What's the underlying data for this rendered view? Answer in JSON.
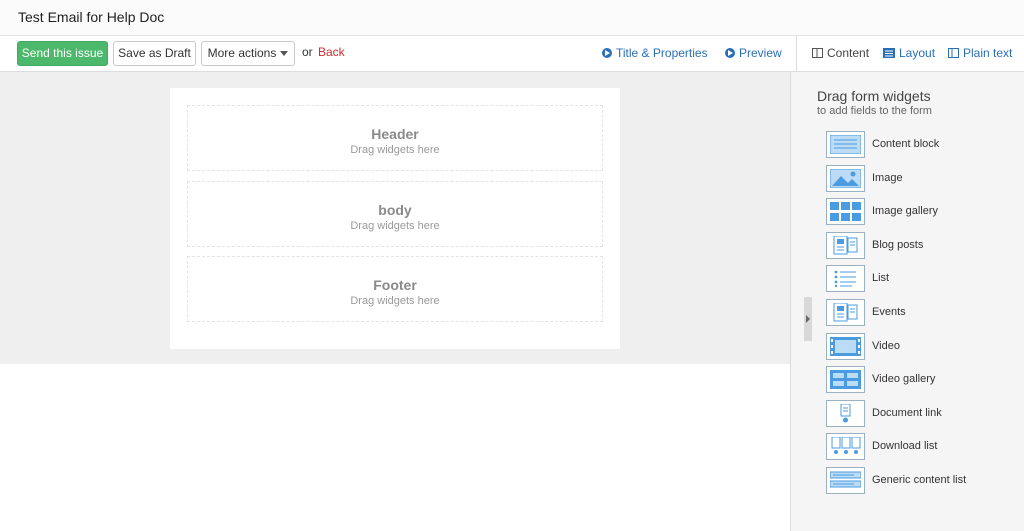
{
  "title": "Test Email for Help Doc",
  "toolbar": {
    "send_label": "Send this issue",
    "draft_label": "Save as Draft",
    "more_label": "More actions",
    "or_text": "or",
    "back_label": "Back",
    "title_props_label": "Title & Properties",
    "preview_label": "Preview",
    "content_label": "Content",
    "layout_label": "Layout",
    "plaintext_label": "Plain text"
  },
  "zones": [
    {
      "title": "Header",
      "hint": "Drag widgets here"
    },
    {
      "title": "body",
      "hint": "Drag widgets here"
    },
    {
      "title": "Footer",
      "hint": "Drag widgets here"
    }
  ],
  "sidebar": {
    "title": "Drag form widgets",
    "subtitle": "to add fields to the form",
    "widgets": [
      {
        "label": "Content block",
        "icon": "content-block-icon"
      },
      {
        "label": "Image",
        "icon": "image-icon"
      },
      {
        "label": "Image gallery",
        "icon": "image-gallery-icon"
      },
      {
        "label": "Blog posts",
        "icon": "blog-posts-icon"
      },
      {
        "label": "List",
        "icon": "list-icon"
      },
      {
        "label": "Events",
        "icon": "events-icon"
      },
      {
        "label": "Video",
        "icon": "video-icon"
      },
      {
        "label": "Video gallery",
        "icon": "video-gallery-icon"
      },
      {
        "label": "Document link",
        "icon": "document-link-icon"
      },
      {
        "label": "Download list",
        "icon": "download-list-icon"
      },
      {
        "label": "Generic content list",
        "icon": "generic-content-list-icon"
      }
    ]
  },
  "colors": {
    "primary_button": "#4cb86b",
    "link": "#2a6fb5",
    "back_link": "#d42b2b",
    "widget_icon": "#4a9be0"
  }
}
